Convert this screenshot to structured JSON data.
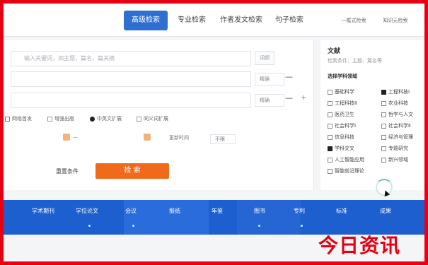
{
  "top_tabs": [
    {
      "label": "高级检索",
      "active": true
    },
    {
      "label": "专业检索",
      "active": false
    },
    {
      "label": "作者发文检索",
      "active": false
    },
    {
      "label": "句子检索",
      "active": false
    }
  ],
  "top_right_links": [
    "一框式检索",
    "知识元检索"
  ],
  "main": {
    "row1": {
      "placeholder": "输入关键词，如主题，篇名，篇关摘",
      "button": "词频"
    },
    "row2": {
      "select": "精确",
      "op": "—"
    },
    "row3": {
      "select": "精确",
      "op": "—",
      "plus": "+"
    },
    "options": [
      {
        "label": "网络首发",
        "kind": "square",
        "checked": false
      },
      {
        "label": "增强出版",
        "kind": "square",
        "checked": false
      },
      {
        "label": "中英文扩展",
        "kind": "circle",
        "checked": true
      },
      {
        "label": "同义词扩展",
        "kind": "square",
        "checked": false
      }
    ],
    "time": {
      "from": "—",
      "update_label": "更新时间",
      "update_value": "不限"
    },
    "reset_label": "重置条件",
    "search_label": "检 索"
  },
  "side": {
    "title": "文献",
    "subtitle": "检索条件：主题、篇名等",
    "categories_heading": "选择学科领域",
    "categories": [
      {
        "label": "基础科学",
        "checked": false
      },
      {
        "label": "工程科技Ⅰ",
        "checked": true
      },
      {
        "label": "工程科技Ⅱ",
        "checked": false
      },
      {
        "label": "农业科技",
        "checked": false
      },
      {
        "label": "医药卫生",
        "checked": false
      },
      {
        "label": "哲学与人文",
        "checked": false
      },
      {
        "label": "社会科学Ⅰ",
        "checked": false
      },
      {
        "label": "社会科学Ⅱ",
        "checked": false
      },
      {
        "label": "信息科技",
        "checked": false
      },
      {
        "label": "经济与管理",
        "checked": false
      },
      {
        "label": "学科交叉",
        "checked": true
      },
      {
        "label": "专题研究",
        "checked": false
      },
      {
        "label": "人工智能应用",
        "checked": false
      },
      {
        "label": "新兴领域",
        "checked": false
      },
      {
        "label": "智能前沿理论",
        "checked": false
      }
    ]
  },
  "bottom_nav": [
    "学术期刊",
    "学位论文",
    "会议",
    "报纸",
    "年鉴",
    "图书",
    "专利",
    "标准",
    "成果"
  ],
  "watermark": "今日资讯",
  "colors": {
    "border": "#e60012",
    "primary": "#2f6fd1",
    "search": "#ef6a1a",
    "bottom_bar": "#1d5fcf"
  }
}
